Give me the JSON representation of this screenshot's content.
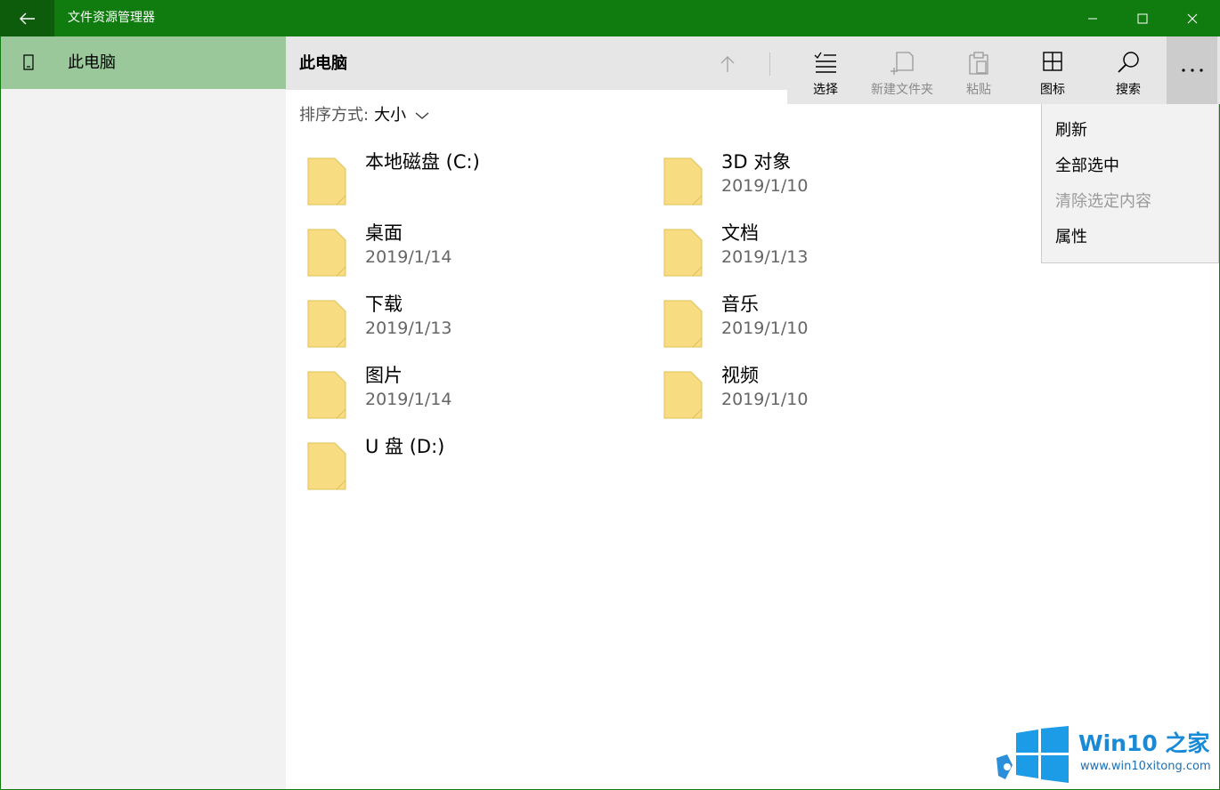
{
  "window": {
    "title": "文件资源管理器"
  },
  "sidebar": {
    "items": [
      {
        "label": "此电脑",
        "icon": "device-icon",
        "selected": true
      }
    ]
  },
  "header": {
    "title": "此电脑"
  },
  "toolbar": {
    "select_label": "选择",
    "new_folder_label": "新建文件夹",
    "paste_label": "粘贴",
    "icons_label": "图标",
    "search_label": "搜索",
    "more_label": "···"
  },
  "menu": {
    "items": [
      {
        "label": "刷新",
        "enabled": true
      },
      {
        "label": "全部选中",
        "enabled": true
      },
      {
        "label": "清除选定内容",
        "enabled": false
      },
      {
        "label": "属性",
        "enabled": true
      }
    ]
  },
  "sort": {
    "prefix": "排序方式:",
    "value": "大小"
  },
  "items": [
    {
      "name": "本地磁盘 (C:)",
      "date": ""
    },
    {
      "name": "3D 对象",
      "date": "2019/1/10"
    },
    {
      "name": "桌面",
      "date": "2019/1/14"
    },
    {
      "name": "文档",
      "date": "2019/1/13"
    },
    {
      "name": "下载",
      "date": "2019/1/13"
    },
    {
      "name": "音乐",
      "date": "2019/1/10"
    },
    {
      "name": "图片",
      "date": "2019/1/14"
    },
    {
      "name": "视频",
      "date": "2019/1/10"
    },
    {
      "name": "U 盘 (D:)",
      "date": ""
    }
  ],
  "watermark": {
    "title": "Win10 之家",
    "url": "www.win10xitong.com"
  },
  "colors": {
    "accent": "#107c10",
    "sidebar_selected": "#9ac89a",
    "folder": "#f8dc82"
  }
}
